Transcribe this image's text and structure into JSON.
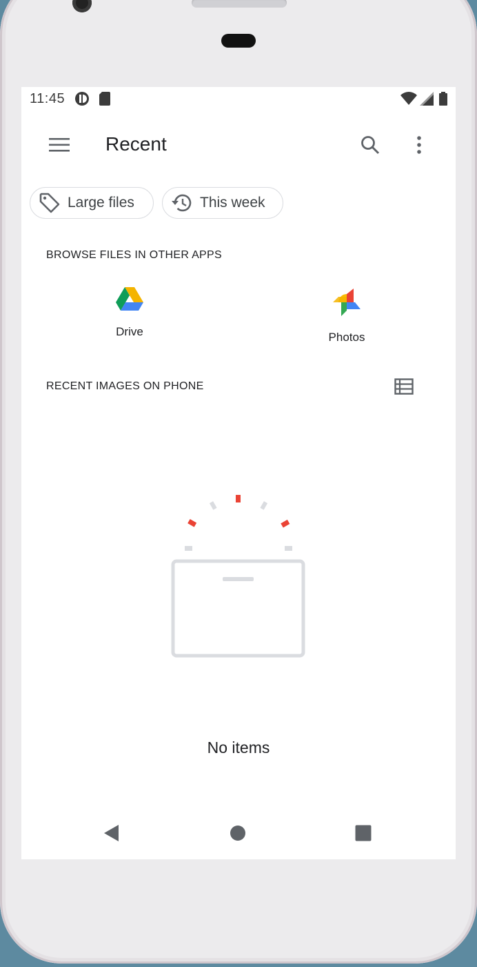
{
  "status_bar": {
    "time": "11:45"
  },
  "app_bar": {
    "title": "Recent"
  },
  "chips": [
    {
      "label": "Large files",
      "icon": "tag-icon"
    },
    {
      "label": "This week",
      "icon": "history-icon"
    }
  ],
  "sections": {
    "browse_header": "BROWSE FILES IN OTHER APPS",
    "recent_header": "RECENT IMAGES ON PHONE"
  },
  "apps": [
    {
      "label": "Drive",
      "icon": "google-drive-icon"
    },
    {
      "label": "Photos",
      "icon": "google-photos-icon"
    }
  ],
  "empty_state": {
    "text": "No items"
  },
  "colors": {
    "accent_red": "#ea4335",
    "gray_mark": "#dadce0",
    "drive_green": "#0f9d58",
    "drive_yellow": "#f4b400",
    "drive_blue": "#4285f4"
  }
}
